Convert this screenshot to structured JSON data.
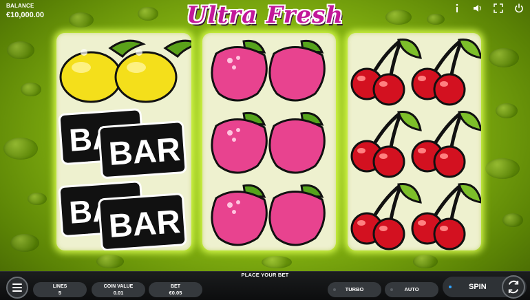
{
  "game": {
    "logo_text": "Ultra Fresh",
    "balance_label": "BALANCE",
    "balance_value": "€10,000.00"
  },
  "top_icons": [
    "info-icon",
    "sound-icon",
    "fullscreen-icon",
    "power-icon"
  ],
  "reels": [
    [
      "lemon",
      "bar",
      "bar"
    ],
    [
      "raspberry",
      "raspberry",
      "raspberry"
    ],
    [
      "cherry",
      "cherry",
      "cherry"
    ]
  ],
  "bar_symbol_text": "BAR",
  "bottom": {
    "status": "PLACE YOUR BET",
    "lines_label": "LINES",
    "lines_value": "5",
    "coin_label": "COIN VALUE",
    "coin_value": "0.01",
    "bet_label": "BET",
    "bet_value": "€0.05",
    "turbo_label": "TURBO",
    "auto_label": "AUTO",
    "spin_label": "SPIN"
  },
  "colors": {
    "background_green": "#86b512",
    "logo_magenta": "#c2189a",
    "reel_bg": "#eef1cf",
    "cherry_red": "#d31120",
    "raspberry_pink": "#e8438f",
    "lemon_yellow": "#f4df1b",
    "spin_dot_blue": "#2fa3ff"
  }
}
